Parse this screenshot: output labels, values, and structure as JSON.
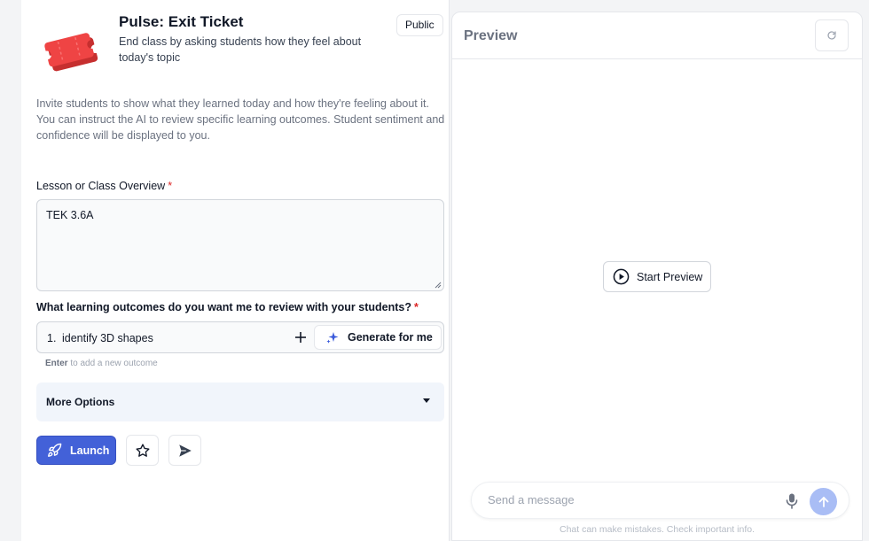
{
  "tool": {
    "title": "Pulse: Exit Ticket",
    "description": "End class by asking students how they feel about today's topic",
    "visibility_badge": "Public",
    "icon": "ticket-icon",
    "intro": "Invite students to show what they learned today and how they're feeling about it. You can instruct the AI to review specific learning outcomes. Student sentiment and confidence will be displayed to you."
  },
  "form": {
    "overview": {
      "label": "Lesson or Class Overview",
      "required_mark": "*",
      "value": "TEK 3.6A"
    },
    "outcomes": {
      "label": "What learning outcomes do you want me to review with your students?",
      "required_mark": "*",
      "items": [
        {
          "number": "1.",
          "text": "identify 3D shapes"
        }
      ],
      "add_icon": "plus-icon",
      "generate_label": "Generate for me",
      "generate_icon": "sparkle-icon",
      "hint_key": "Enter",
      "hint_text": " to add a new outcome"
    },
    "more_options_label": "More Options"
  },
  "actions": {
    "launch_label": "Launch",
    "launch_icon": "rocket-icon",
    "star_icon": "star-icon",
    "send_icon": "paper-plane-icon"
  },
  "preview": {
    "title": "Preview",
    "refresh_icon": "refresh-icon",
    "start_label": "Start Preview",
    "start_icon": "play-circle-icon",
    "message_placeholder": "Send a message",
    "mic_icon": "microphone-icon",
    "submit_icon": "arrow-up-icon",
    "disclaimer": "Chat can make mistakes. Check important info."
  },
  "colors": {
    "primary": "#4361d8",
    "required": "#dc2626",
    "ticket": "#ef4444",
    "submit_disabled": "#a9bdf5",
    "more_options_bg": "#f1f5fb"
  }
}
